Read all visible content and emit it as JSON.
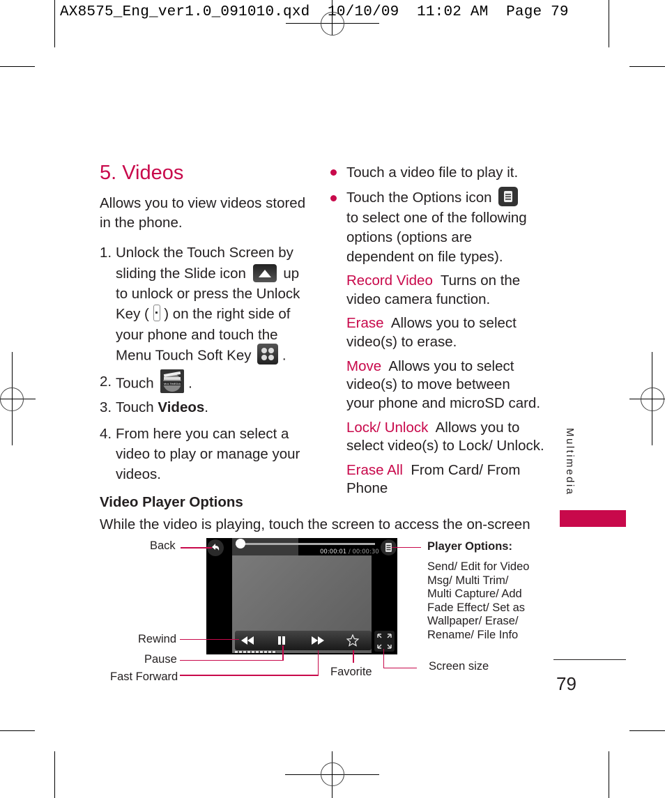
{
  "slug": "AX8575_Eng_ver1.0_091010.qxd  10/10/09  11:02 AM  Page 79",
  "section_title": "5. Videos",
  "intro": [
    "Allows you to view videos stored",
    "in the phone."
  ],
  "steps": {
    "s1": {
      "num": "1.",
      "l1": "Unlock the Touch Screen by",
      "l2a": "sliding the Slide icon",
      "l2b": "up",
      "l3": "to unlock or press the Unlock",
      "l4a": "Key (",
      "l4b": ") on the right side of",
      "l5": "your phone and touch the",
      "l6a": "Menu Touch Soft Key",
      "l6b": "."
    },
    "s2": {
      "num": "2.",
      "text": "Touch",
      "end": "."
    },
    "s3": {
      "num": "3.",
      "text": "Touch",
      "bold": "Videos",
      "end": "."
    },
    "s4": {
      "num": "4.",
      "l1": "From here you can select a",
      "l2": "video to play or manage your",
      "l3": "videos."
    }
  },
  "icons": {
    "slide": "slide-up-icon",
    "unlock_key": "unlock-key-icon",
    "menu_soft_key": "menu-soft-key-icon",
    "multimedia": "multimedia-icon",
    "multimedia_label": "MULTIMEDIA",
    "options": "options-icon"
  },
  "subheading": "Video Player Options",
  "player_intro": "While the video is playing, touch the screen to access the on-screen",
  "bullets": {
    "b1": "Touch a video file to play it.",
    "b2": {
      "l1": "Touch the Options icon",
      "l2": "to select one of the following",
      "l3": "options (options are",
      "l4": "dependent on file types)."
    }
  },
  "options": [
    {
      "term": "Record Video",
      "l1": "Turns on the",
      "l2": "video camera function."
    },
    {
      "term": "Erase",
      "l1": "Allows you to select",
      "l2": "video(s) to erase."
    },
    {
      "term": "Move",
      "l1": "Allows you to select",
      "l2": "video(s) to move between",
      "l3": "your phone and microSD card."
    },
    {
      "term": "Lock/ Unlock",
      "l1": "Allows you to",
      "l2": "select video(s) to Lock/ Unlock."
    },
    {
      "term": "Erase All",
      "l1": "From Card/ From",
      "l2": "Phone"
    }
  ],
  "player": {
    "time_current": "00:00:01",
    "time_total": "/ 00:00:30",
    "progress_fraction": 0.033
  },
  "callouts": {
    "back": "Back",
    "rewind": "Rewind",
    "pause": "Pause",
    "fast_forward": "Fast Forward",
    "favorite": "Favorite",
    "screen_size": "Screen size",
    "player_options_title": "Player Options:",
    "player_options_lines": [
      "Send/ Edit for Video",
      "Msg/ Multi Trim/",
      "Multi Capture/ Add",
      "Fade Effect/ Set as",
      "Wallpaper/ Erase/",
      "Rename/ File Info"
    ]
  },
  "side_tab": "Multimedia",
  "page_number": "79",
  "colors": {
    "accent": "#c8094b",
    "text": "#231f20"
  }
}
